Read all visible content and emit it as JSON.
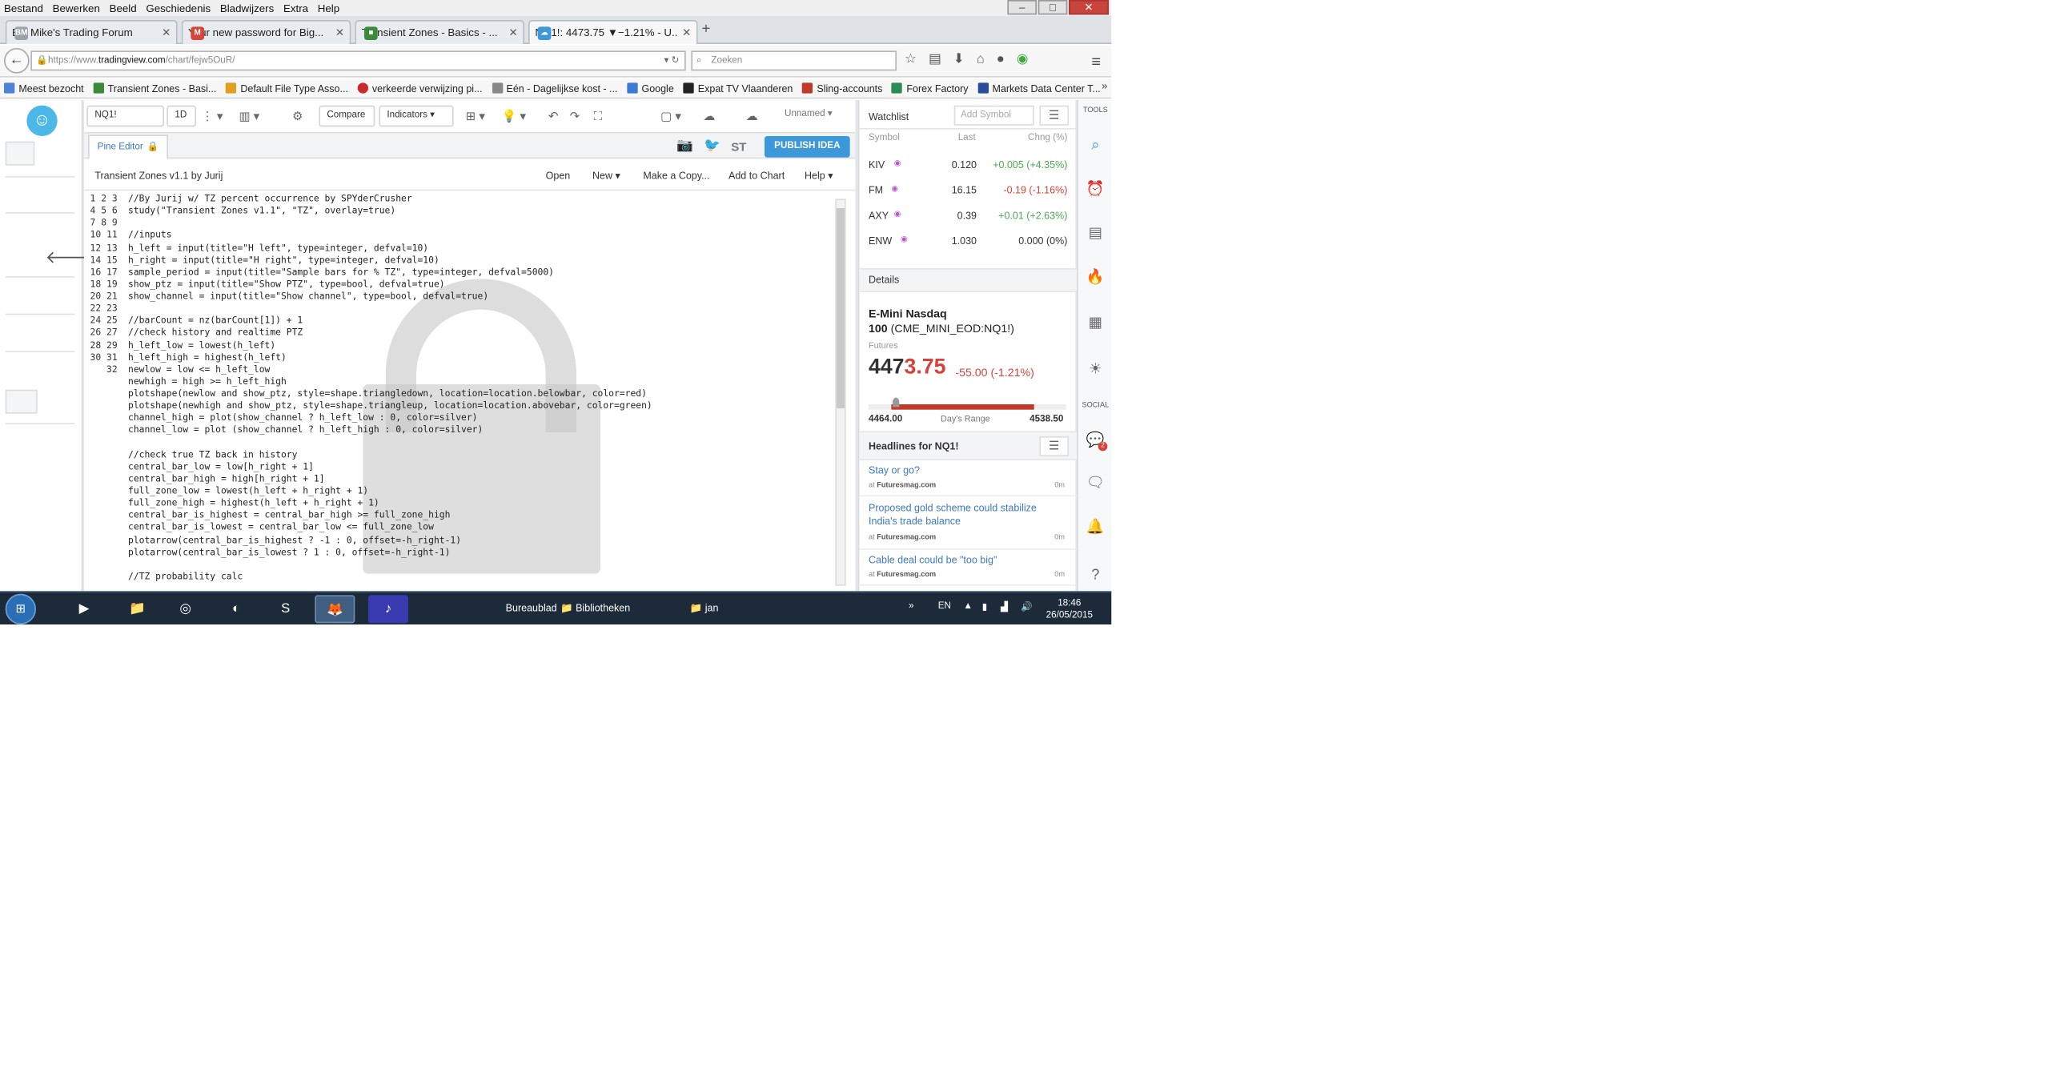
{
  "menubar": {
    "items": [
      "Bestand",
      "Bewerken",
      "Beeld",
      "Geschiedenis",
      "Bladwijzers",
      "Extra",
      "Help"
    ]
  },
  "window_controls": {
    "minimize": "–",
    "maximize": "□",
    "close": "✕"
  },
  "tabs": [
    {
      "label": "Big Mike's Trading Forum",
      "icon": "BM",
      "color": "#9aa2ab"
    },
    {
      "label": "Your new password for Big...",
      "icon": "M",
      "color": "#d44638"
    },
    {
      "label": "Transient Zones - Basics - ...",
      "icon": "■",
      "color": "#3b8a3b"
    },
    {
      "label": "NQ1!: 4473.75 ▼−1.21% - U...",
      "icon": "☁",
      "color": "#3c98d8"
    }
  ],
  "tab_close_glyph": "✕",
  "new_tab_glyph": "+",
  "nav": {
    "url_dim": "https://www.",
    "url_domain": "tradingview.com",
    "url_path": "/chart/fejw5OuR/",
    "search_placeholder": "Zoeken"
  },
  "bookmarks": [
    {
      "label": "Meest bezocht",
      "color": "#4b84d6"
    },
    {
      "label": "Transient Zones - Basi...",
      "color": "#3b8a3b"
    },
    {
      "label": "Default File Type Asso...",
      "color": "#e0a020"
    },
    {
      "label": "verkeerde verwijzing pi...",
      "color": "#cc2b2b"
    },
    {
      "label": "Eén - Dagelijkse kost - ...",
      "color": "#888888"
    },
    {
      "label": "Google",
      "color": "#3b7bd6"
    },
    {
      "label": "Expat TV Vlaanderen",
      "color": "#222222"
    },
    {
      "label": "Sling-accounts",
      "color": "#c0392b"
    },
    {
      "label": "Forex Factory",
      "color": "#2e8b57"
    },
    {
      "label": "Markets Data Center T...",
      "color": "#2b4c9c"
    }
  ],
  "bookmarks_more": "»",
  "toolbar": {
    "symbol": "NQ1!",
    "interval": "1D",
    "compare": "Compare",
    "indicators": "Indicators",
    "layout_name": "Unnamed"
  },
  "pine": {
    "tab_label": "Pine Editor",
    "publish": "PUBLISH IDEA",
    "share_st": "ST"
  },
  "editor": {
    "title": "Transient Zones v1.1 by Jurij",
    "menu": [
      "Open",
      "New ▾",
      "Make a Copy...",
      "Add to Chart",
      "Help ▾"
    ],
    "code": "//By Jurij w/ TZ percent occurrence by SPYderCrusher\nstudy(\"Transient Zones v1.1\", \"TZ\", overlay=true)\n\n//inputs\nh_left = input(title=\"H left\", type=integer, defval=10)\nh_right = input(title=\"H right\", type=integer, defval=10)\nsample_period = input(title=\"Sample bars for % TZ\", type=integer, defval=5000)\nshow_ptz = input(title=\"Show PTZ\", type=bool, defval=true)\nshow_channel = input(title=\"Show channel\", type=bool, defval=true)\n\n//barCount = nz(barCount[1]) + 1\n//check history and realtime PTZ\nh_left_low = lowest(h_left)\nh_left_high = highest(h_left)\nnewlow = low <= h_left_low\nnewhigh = high >= h_left_high\nplotshape(newlow and show_ptz, style=shape.triangledown, location=location.belowbar, color=red)\nplotshape(newhigh and show_ptz, style=shape.triangleup, location=location.abovebar, color=green)\nchannel_high = plot(show_channel ? h_left_low : 0, color=silver)\nchannel_low = plot (show_channel ? h_left_high : 0, color=silver)\n\n//check true TZ back in history\ncentral_bar_low = low[h_right + 1]\ncentral_bar_high = high[h_right + 1]\nfull_zone_low = lowest(h_left + h_right + 1)\nfull_zone_high = highest(h_left + h_right + 1)\ncentral_bar_is_highest = central_bar_high >= full_zone_high\ncentral_bar_is_lowest = central_bar_low <= full_zone_low\nplotarrow(central_bar_is_highest ? -1 : 0, offset=-h_right-1)\nplotarrow(central_bar_is_lowest ? 1 : 0, offset=-h_right-1)\n\n//TZ probability calc",
    "line_numbers": "1\n2\n3\n4\n5\n6\n7\n8\n9\n10\n11\n12\n13\n14\n15\n16\n17\n18\n19\n20\n21\n22\n23\n24\n25\n26\n27\n28\n29\n30\n31\n32"
  },
  "watchlist": {
    "title": "Watchlist",
    "add_placeholder": "Add Symbol",
    "cols": {
      "symbol": "Symbol",
      "last": "Last",
      "change": "Chng (%)"
    },
    "rows": [
      {
        "symbol": "KIV",
        "last": "0.120",
        "change": "+0.005 (+4.35%)",
        "dir": "pos"
      },
      {
        "symbol": "FM",
        "last": "16.15",
        "change": "-0.19 (-1.16%)",
        "dir": "neg"
      },
      {
        "symbol": "AXY",
        "last": "0.39",
        "change": "+0.01 (+2.63%)",
        "dir": "pos"
      },
      {
        "symbol": "ENW",
        "last": "1.030",
        "change": "0.000 (0%)",
        "dir": "neu"
      }
    ]
  },
  "details": {
    "section": "Details",
    "name_line1": "E-Mini Nasdaq",
    "name_line2_bold": "100",
    "name_line2": "(CME_MINI_EOD:NQ1!)",
    "type": "Futures",
    "price_main": "447",
    "price_tail": "3.75",
    "change": "-55.00 (-1.21%)",
    "range_low": "4464.00",
    "range_label": "Day's Range",
    "range_high": "4538.50"
  },
  "headlines": {
    "title": "Headlines for NQ1!",
    "items": [
      {
        "title": "Stay or go?",
        "source_prefix": "at",
        "source": "Futuresmag.com",
        "age": "0m"
      },
      {
        "title": "Proposed gold scheme could stabilize India's trade balance",
        "source_prefix": "at",
        "source": "Futuresmag.com",
        "age": "0m"
      },
      {
        "title": "Cable deal could be \"too big\"",
        "source_prefix": "at",
        "source": "Futuresmag.com",
        "age": "0m"
      }
    ]
  },
  "tools": {
    "label": "TOOLS",
    "social": "SOCIAL",
    "badge": "2"
  },
  "taskbar": {
    "desktop": "Bureaublad",
    "libraries": "Bibliotheken",
    "user": "jan",
    "lang": "EN",
    "time": "18:46",
    "date": "26/05/2015"
  }
}
